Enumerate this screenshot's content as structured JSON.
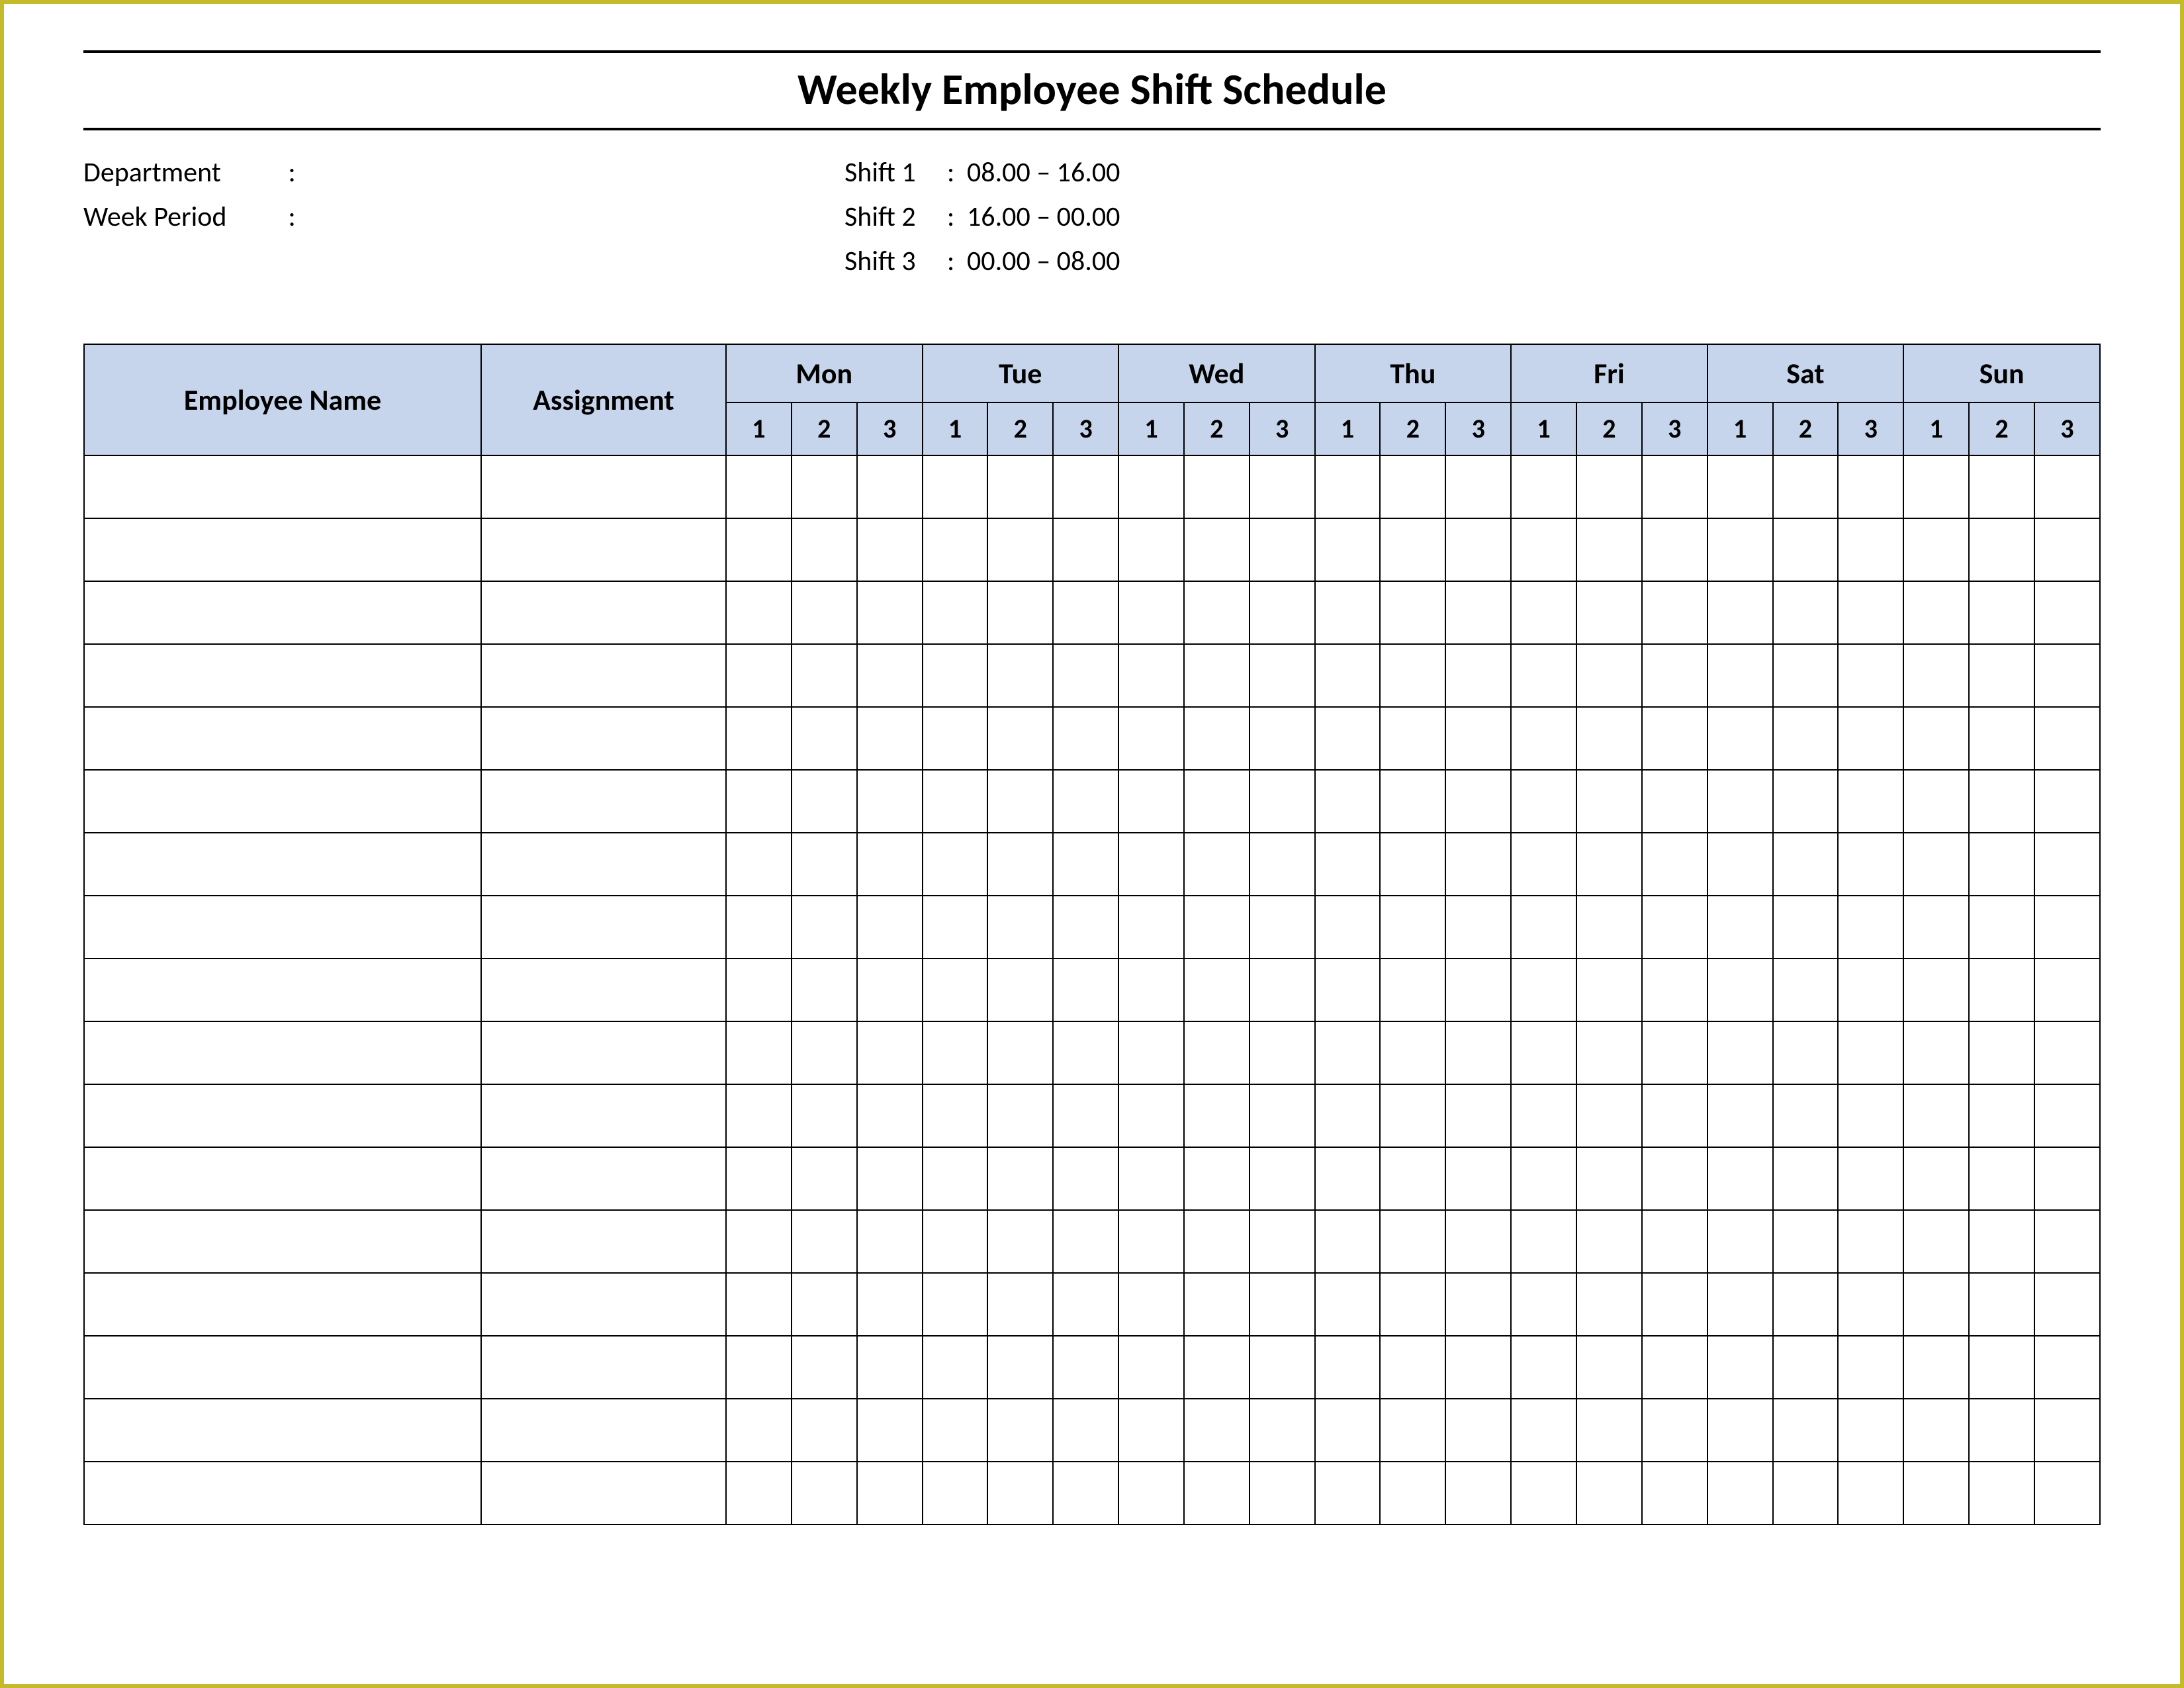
{
  "title": "Weekly Employee Shift Schedule",
  "meta": {
    "department_label": "Department",
    "department_value": "",
    "week_period_label": "Week  Period",
    "week_period_value": "",
    "shifts": [
      {
        "label": "Shift 1",
        "value": "08.00  – 16.00"
      },
      {
        "label": "Shift 2",
        "value": "16.00  – 00.00"
      },
      {
        "label": "Shift 3",
        "value": "00.00  – 08.00"
      }
    ]
  },
  "table": {
    "headers": {
      "employee_name": "Employee Name",
      "assignment": "Assignment",
      "days": [
        "Mon",
        "Tue",
        "Wed",
        "Thu",
        "Fri",
        "Sat",
        "Sun"
      ],
      "subshifts": [
        "1",
        "2",
        "3"
      ]
    },
    "row_count": 17
  },
  "colors": {
    "page_border": "#c4bb2a",
    "header_fill": "#c6d5eb",
    "grid_line": "#000000"
  }
}
